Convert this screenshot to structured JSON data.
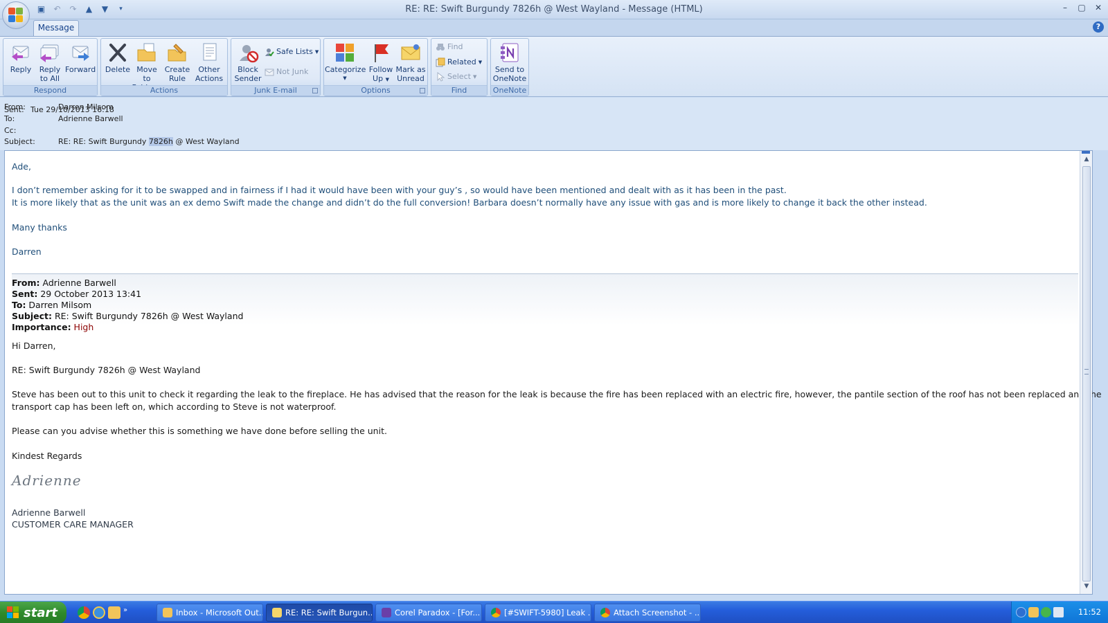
{
  "window": {
    "title": "RE: RE: Swift Burgundy 7826h @ West Wayland - Message (HTML)"
  },
  "quick_access": [
    "save-icon",
    "undo-icon",
    "redo-icon",
    "previous-item-icon",
    "next-item-icon",
    "customize-icon"
  ],
  "ribbon": {
    "tab": "Message",
    "groups": {
      "respond": {
        "label": "Respond",
        "reply": "Reply",
        "reply_all_1": "Reply",
        "reply_all_2": "to All",
        "forward": "Forward"
      },
      "actions": {
        "label": "Actions",
        "delete": "Delete",
        "move_1": "Move to",
        "move_2": "Folder",
        "rule_1": "Create",
        "rule_2": "Rule",
        "other_1": "Other",
        "other_2": "Actions"
      },
      "junk": {
        "label": "Junk E-mail",
        "block_1": "Block",
        "block_2": "Sender",
        "safe_lists": "Safe Lists",
        "not_junk": "Not Junk"
      },
      "options": {
        "label": "Options",
        "categorize": "Categorize",
        "follow_1": "Follow",
        "follow_2": "Up",
        "mark_1": "Mark as",
        "mark_2": "Unread"
      },
      "find": {
        "label": "Find",
        "find": "Find",
        "related": "Related",
        "select": "Select"
      },
      "onenote": {
        "label": "OneNote",
        "send_1": "Send to",
        "send_2": "OneNote"
      }
    }
  },
  "header": {
    "from_label": "From:",
    "from": "Darren Milsom",
    "to_label": "To:",
    "to": "Adrienne Barwell",
    "cc_label": "Cc:",
    "subject_label": "Subject:",
    "subject_pre": "RE: RE: Swift Burgundy ",
    "subject_sel": "7826h",
    "subject_post": " @ West Wayland",
    "sent_label": "Sent:",
    "sent": "Tue 29/10/2013 16:18"
  },
  "body": {
    "greeting": "Ade,",
    "line1": "I don’t remember asking for it to be swapped and in fairness if I had it would have been with your guy’s , so would have been mentioned and dealt with as it has been in the past.",
    "line2": "It is more likely that as the unit was an ex demo Swift made the change and didn’t do the full conversion! Barbara doesn’t normally have any issue with gas and is more likely to change it back the other instead.",
    "thanks": "Many thanks",
    "signoff": "Darren",
    "quoted": {
      "from_label": "From:",
      "from": " Adrienne Barwell",
      "sent_label": "Sent:",
      "sent": " 29 October 2013 13:41",
      "to_label": "To:",
      "to": " Darren Milsom",
      "subject_label": "Subject:",
      "subject": " RE: Swift Burgundy 7826h @ West Wayland",
      "importance_label": "Importance:",
      "importance": " High"
    },
    "q_greeting": "Hi Darren,",
    "q_subject": "RE: Swift Burgundy 7826h @ West Wayland",
    "q_para1a": "Steve has been out to this unit to check it regarding the leak to the fireplace.  He has advised that the reason for the leak is because the fire has been replaced with an electric fire, however, the pantile section of the roof has not been replaced and the",
    "q_para1b": "transport cap has been left on, which according to Steve is not waterproof.",
    "q_para2": "Please can you advise whether  this is something we have done before selling the unit.",
    "q_regards": "Kindest Regards",
    "q_signature": "Adrienne",
    "q_name": "Adrienne Barwell",
    "q_title": "CUSTOMER CARE MANAGER"
  },
  "taskbar": {
    "start": "start",
    "items": [
      "Inbox - Microsoft Out...",
      "RE: RE: Swift Burgun...",
      "Corel Paradox - [For...",
      "[#SWIFT-5980] Leak ...",
      "Attach Screenshot - ..."
    ],
    "clock": "11:52"
  },
  "colors": {
    "accent": "#15428b",
    "body_text": "#1f4e79",
    "importance": "#8b0000"
  }
}
